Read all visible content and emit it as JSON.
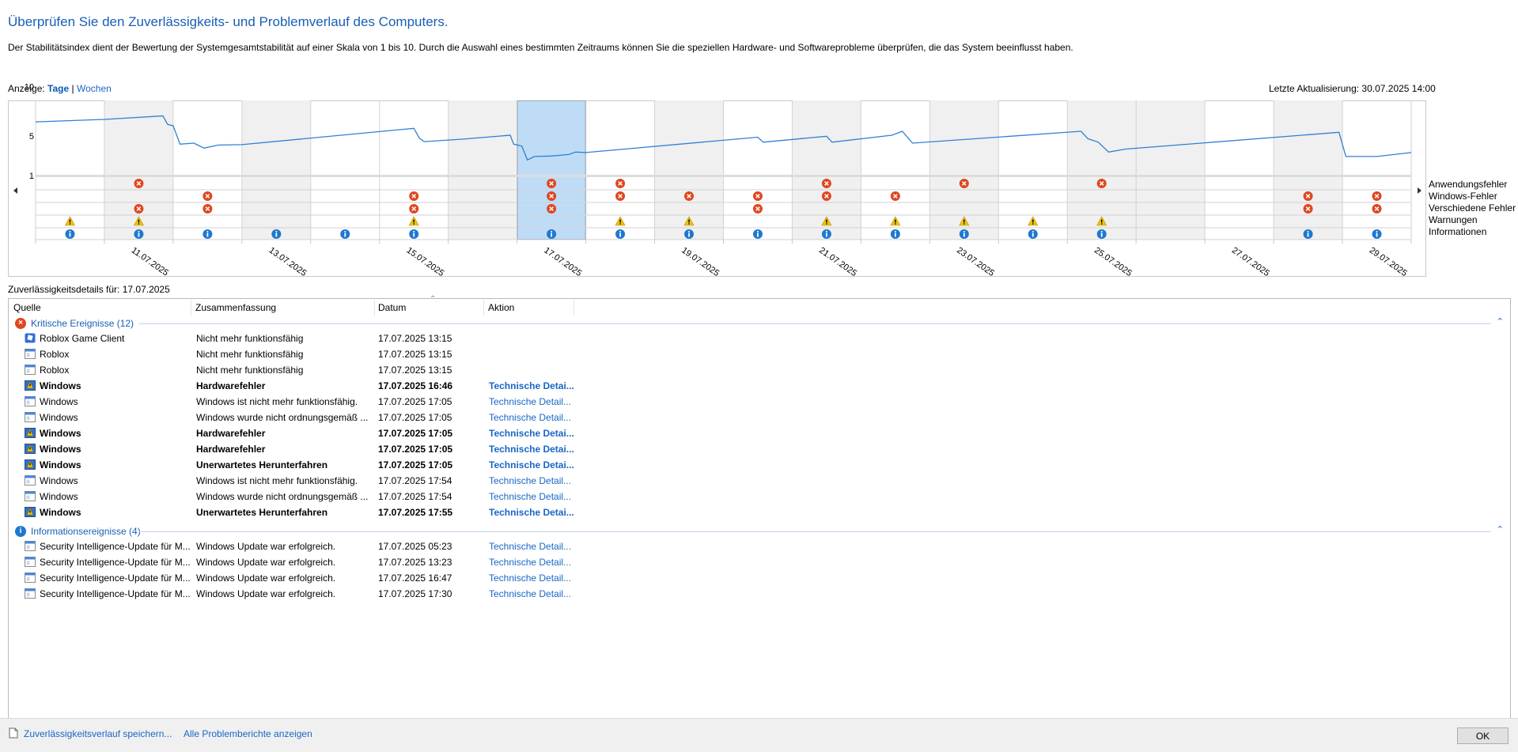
{
  "page": {
    "title": "Überprüfen Sie den Zuverlässigkeits- und Problemverlauf des Computers.",
    "description": "Der Stabilitätsindex dient der Bewertung der Systemgesamtstabilität auf einer Skala von 1 bis 10. Durch die Auswahl eines bestimmten Zeitraums können Sie die speziellen Hardware- und Softwareprobleme überprüfen, die das System beeinflusst haben."
  },
  "view": {
    "label": "Anzeige:",
    "days": "Tage",
    "separator": "|",
    "weeks": "Wochen",
    "last_update": "Letzte Aktualisierung: 30.07.2025 14:00"
  },
  "colors": {
    "accent": "#1a5fb4",
    "link": "#1a66c6",
    "line": "#2f7fd4",
    "selected": "#bfdcf7",
    "shaded": "#f0f0f0",
    "error": "#e0461f",
    "warning": "#f2c400",
    "info": "#1e78cf"
  },
  "chart_data": {
    "type": "line",
    "ylim": [
      1,
      10
    ],
    "y_ticks": [
      "10",
      "5",
      "1"
    ],
    "x_labels": [
      "11.07.2025",
      "13.07.2025",
      "15.07.2025",
      "17.07.2025",
      "19.07.2025",
      "21.07.2025",
      "23.07.2025",
      "25.07.2025",
      "27.07.2025",
      "29.07.2025"
    ],
    "num_days": 20,
    "first_day": "10.07.2025",
    "selected_day": 7,
    "shaded_days": [
      1,
      3,
      6,
      9,
      11,
      13,
      15,
      16,
      18
    ],
    "stability_line": [
      [
        0.0,
        6.35
      ],
      [
        1.0,
        6.6
      ],
      [
        1.85,
        6.95
      ],
      [
        1.92,
        6.1
      ],
      [
        2.0,
        5.95
      ],
      [
        2.1,
        4.1
      ],
      [
        2.3,
        4.2
      ],
      [
        2.45,
        3.7
      ],
      [
        2.65,
        4.0
      ],
      [
        3.0,
        4.05
      ],
      [
        5.5,
        5.7
      ],
      [
        5.58,
        4.7
      ],
      [
        5.65,
        4.35
      ],
      [
        6.2,
        4.6
      ],
      [
        6.9,
        5.0
      ],
      [
        6.95,
        4.1
      ],
      [
        7.07,
        3.9
      ],
      [
        7.15,
        2.5
      ],
      [
        7.25,
        2.85
      ],
      [
        7.5,
        2.9
      ],
      [
        7.75,
        3.05
      ],
      [
        7.85,
        3.3
      ],
      [
        8.0,
        3.25
      ],
      [
        10.5,
        4.8
      ],
      [
        10.58,
        4.3
      ],
      [
        11.5,
        4.9
      ],
      [
        11.58,
        4.3
      ],
      [
        12.45,
        5.0
      ],
      [
        12.6,
        5.4
      ],
      [
        12.75,
        4.2
      ],
      [
        15.2,
        5.4
      ],
      [
        15.3,
        4.65
      ],
      [
        15.45,
        4.3
      ],
      [
        15.6,
        3.3
      ],
      [
        15.85,
        3.6
      ],
      [
        18.95,
        5.3
      ],
      [
        19.05,
        2.85
      ],
      [
        19.5,
        2.85
      ],
      [
        20.0,
        3.25
      ]
    ],
    "rows": [
      "Anwendungsfehler",
      "Windows-Fehler",
      "Verschiedene Fehler",
      "Warnungen",
      "Informationen"
    ],
    "events": {
      "application_errors": [
        1,
        7,
        8,
        11,
        13,
        15
      ],
      "windows_errors": [
        2,
        5,
        7,
        8,
        9,
        10,
        11,
        12,
        18,
        19
      ],
      "misc_errors": [
        1,
        2,
        5,
        7,
        10,
        18,
        19
      ],
      "warnings": [
        0,
        1,
        5,
        8,
        9,
        11,
        12,
        13,
        14,
        15
      ],
      "information": [
        0,
        1,
        2,
        3,
        4,
        5,
        7,
        8,
        9,
        10,
        11,
        12,
        13,
        14,
        15,
        18,
        19
      ]
    }
  },
  "details": {
    "label": "Zuverlässigkeitsdetails für: 17.07.2025",
    "columns": [
      "Quelle",
      "Zusammenfassung",
      "Datum",
      "Aktion"
    ],
    "groups": [
      {
        "label": "Kritische Ereignisse (12)",
        "type": "error",
        "icon_glyph": "×",
        "rows": [
          {
            "source": "Roblox Game Client",
            "summary": "Nicht mehr funktionsfähig",
            "date": "17.07.2025 13:15",
            "action": "",
            "bold": false,
            "icon": "roblox"
          },
          {
            "source": "Roblox",
            "summary": "Nicht mehr funktionsfähig",
            "date": "17.07.2025 13:15",
            "action": "",
            "bold": false,
            "icon": "app"
          },
          {
            "source": "Roblox",
            "summary": "Nicht mehr funktionsfähig",
            "date": "17.07.2025 13:15",
            "action": "",
            "bold": false,
            "icon": "app"
          },
          {
            "source": "Windows",
            "summary": "Hardwarefehler",
            "date": "17.07.2025 16:46",
            "action": "Technische Detai...",
            "bold": true,
            "icon": "win"
          },
          {
            "source": "Windows",
            "summary": "Windows ist nicht mehr funktionsfähig.",
            "date": "17.07.2025 17:05",
            "action": "Technische Detail...",
            "bold": false,
            "icon": "app"
          },
          {
            "source": "Windows",
            "summary": "Windows wurde nicht ordnungsgemäß ...",
            "date": "17.07.2025 17:05",
            "action": "Technische Detail...",
            "bold": false,
            "icon": "app"
          },
          {
            "source": "Windows",
            "summary": "Hardwarefehler",
            "date": "17.07.2025 17:05",
            "action": "Technische Detai...",
            "bold": true,
            "icon": "win"
          },
          {
            "source": "Windows",
            "summary": "Hardwarefehler",
            "date": "17.07.2025 17:05",
            "action": "Technische Detai...",
            "bold": true,
            "icon": "win"
          },
          {
            "source": "Windows",
            "summary": "Unerwartetes Herunterfahren",
            "date": "17.07.2025 17:05",
            "action": "Technische Detai...",
            "bold": true,
            "icon": "win"
          },
          {
            "source": "Windows",
            "summary": "Windows ist nicht mehr funktionsfähig.",
            "date": "17.07.2025 17:54",
            "action": "Technische Detail...",
            "bold": false,
            "icon": "app"
          },
          {
            "source": "Windows",
            "summary": "Windows wurde nicht ordnungsgemäß ...",
            "date": "17.07.2025 17:54",
            "action": "Technische Detail...",
            "bold": false,
            "icon": "app"
          },
          {
            "source": "Windows",
            "summary": "Unerwartetes Herunterfahren",
            "date": "17.07.2025 17:55",
            "action": "Technische Detai...",
            "bold": true,
            "icon": "win"
          }
        ]
      },
      {
        "label": "Informationsereignisse (4)",
        "type": "info",
        "icon_glyph": "i",
        "rows": [
          {
            "source": "Security Intelligence-Update für M...",
            "summary": "Windows Update war erfolgreich.",
            "date": "17.07.2025 05:23",
            "action": "Technische Detail...",
            "bold": false,
            "icon": "app"
          },
          {
            "source": "Security Intelligence-Update für M...",
            "summary": "Windows Update war erfolgreich.",
            "date": "17.07.2025 13:23",
            "action": "Technische Detail...",
            "bold": false,
            "icon": "app"
          },
          {
            "source": "Security Intelligence-Update für M...",
            "summary": "Windows Update war erfolgreich.",
            "date": "17.07.2025 16:47",
            "action": "Technische Detail...",
            "bold": false,
            "icon": "app"
          },
          {
            "source": "Security Intelligence-Update für M...",
            "summary": "Windows Update war erfolgreich.",
            "date": "17.07.2025 17:30",
            "action": "Technische Detail...",
            "bold": false,
            "icon": "app"
          }
        ]
      }
    ]
  },
  "footer": {
    "save_link": "Zuverlässigkeitsverlauf speichern...",
    "all_reports_link": "Alle Problemberichte anzeigen",
    "ok_label": "OK"
  }
}
